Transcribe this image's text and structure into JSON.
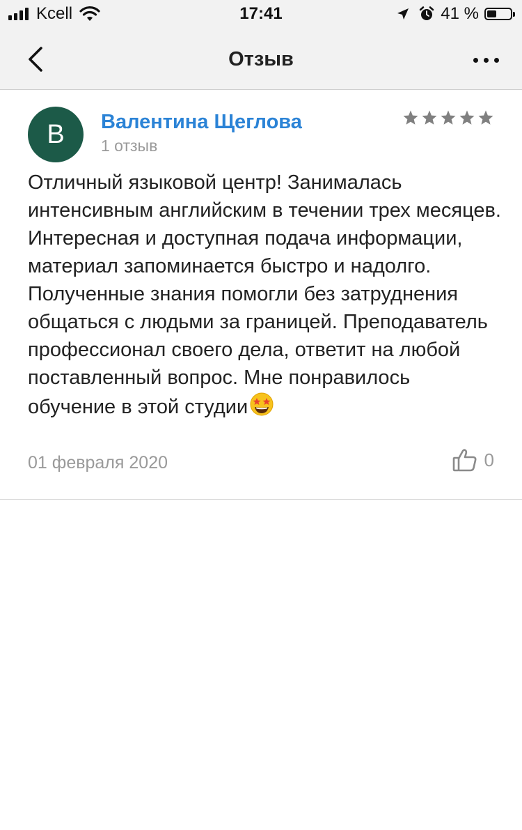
{
  "status_bar": {
    "carrier": "Kcell",
    "time": "17:41",
    "battery_percent": "41 %",
    "battery_level": 0.41
  },
  "nav": {
    "title": "Отзыв"
  },
  "review": {
    "avatar_letter": "В",
    "author": "Валентина Щеглова",
    "author_reviews": "1 отзыв",
    "rating": 5,
    "rating_max": 5,
    "text": "Отличный языковой центр! Занималась интенсивным английским в течении трех месяцев. Интересная и доступная подача информации, материал запоминается быстро и надолго. Полученные знания помогли без затруднения общаться с людьми за границей. Преподаватель профессионал своего дела, ответит на любой поставленный вопрос. Мне понравилось обучение в этой студии",
    "date": "01 февраля 2020",
    "likes": "0"
  },
  "colors": {
    "accent_link": "#2b83d6",
    "avatar_bg": "#1c5a48",
    "star": "#808080"
  },
  "icons": [
    "signal-icon",
    "wifi-icon",
    "location-arrow-icon",
    "alarm-icon",
    "battery-icon",
    "back-chevron-icon",
    "more-dots-icon",
    "star-icon",
    "star-struck-emoji-icon",
    "thumbs-up-icon"
  ]
}
